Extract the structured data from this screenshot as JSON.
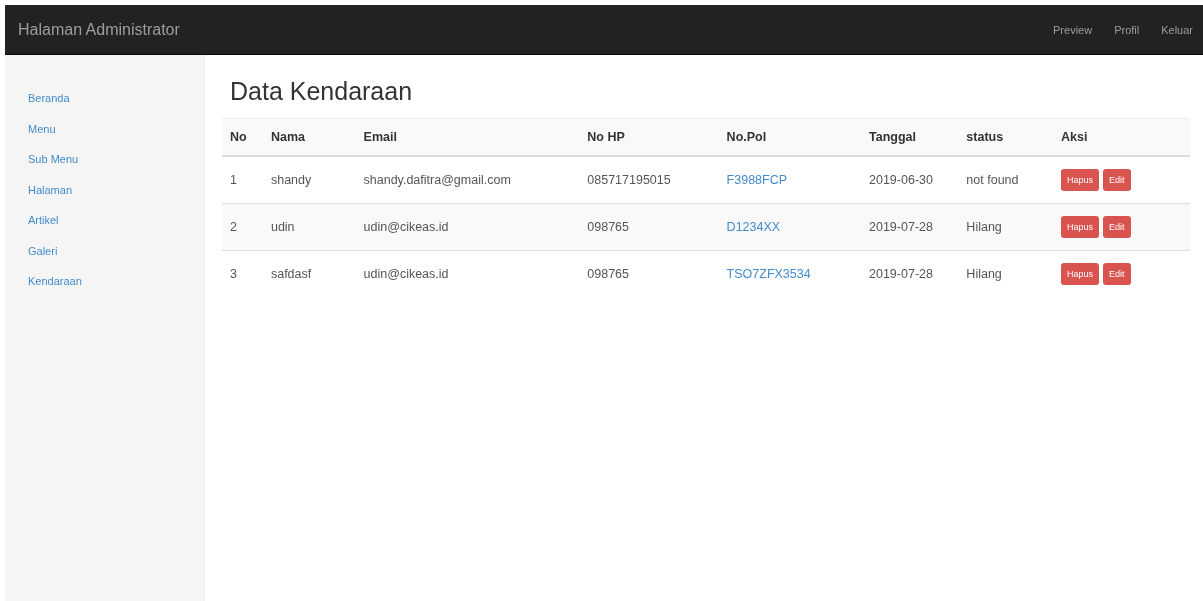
{
  "navbar": {
    "brand": "Halaman Administrator",
    "links": [
      "Preview",
      "Profil",
      "Keluar"
    ]
  },
  "sidebar": {
    "items": [
      "Beranda",
      "Menu",
      "Sub Menu",
      "Halaman",
      "Artikel",
      "Galeri",
      "Kendaraan"
    ]
  },
  "page": {
    "title": "Data Kendaraan"
  },
  "table": {
    "columns": [
      "No",
      "Nama",
      "Email",
      "No HP",
      "No.Pol",
      "Tanggal",
      "status",
      "Aksi"
    ],
    "rows": [
      {
        "no": "1",
        "nama": "shandy",
        "email": "shandy.dafitra@gmail.com",
        "hp": "085717195015",
        "nopol": "F3988FCP",
        "tanggal": "2019-06-30",
        "status": "not found",
        "actions": [
          "Hapus",
          "Edit"
        ]
      },
      {
        "no": "2",
        "nama": "udin",
        "email": "udin@cikeas.id",
        "hp": "098765",
        "nopol": "D1234XX",
        "tanggal": "2019-07-28",
        "status": "Hilang",
        "actions": [
          "Hapus",
          "Edit"
        ]
      },
      {
        "no": "3",
        "nama": "safdasf",
        "email": "udin@cikeas.id",
        "hp": "098765",
        "nopol": "TSO7ZFX3534",
        "tanggal": "2019-07-28",
        "status": "Hilang",
        "actions": [
          "Hapus",
          "Edit"
        ]
      }
    ]
  }
}
